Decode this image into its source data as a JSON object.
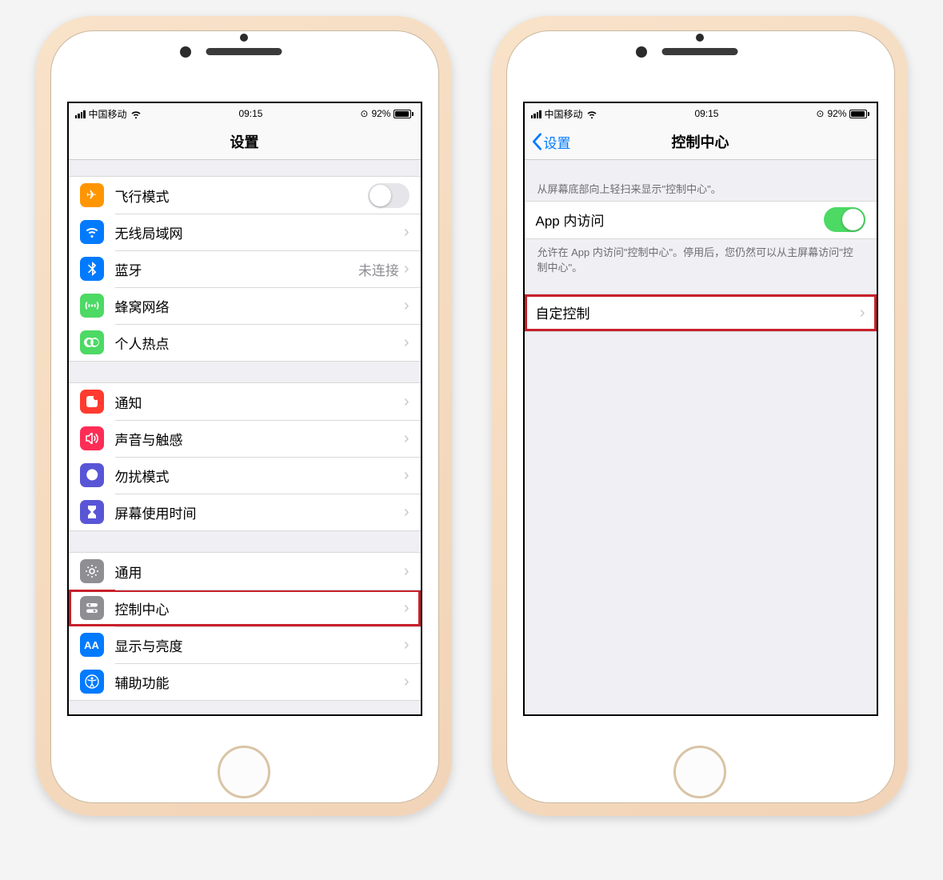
{
  "statusbar": {
    "carrier": "中国移动",
    "time": "09:15",
    "battery_pct": "92%"
  },
  "left": {
    "title": "设置",
    "rows": {
      "airplane": "飞行模式",
      "wifi": "无线局域网",
      "bluetooth": "蓝牙",
      "bluetooth_detail": "未连接",
      "cellular": "蜂窝网络",
      "hotspot": "个人热点",
      "notifications": "通知",
      "sounds": "声音与触感",
      "dnd": "勿扰模式",
      "screentime": "屏幕使用时间",
      "general": "通用",
      "controlcenter": "控制中心",
      "display": "显示与亮度",
      "accessibility": "辅助功能"
    }
  },
  "right": {
    "back": "设置",
    "title": "控制中心",
    "header_text": "从屏幕底部向上轻扫来显示\"控制中心\"。",
    "inapp_label": "App 内访问",
    "inapp_footer": "允许在 App 内访问\"控制中心\"。停用后，您仍然可以从主屏幕访问\"控制中心\"。",
    "customize": "自定控制"
  },
  "toggle_off_knob_indicator": "○"
}
